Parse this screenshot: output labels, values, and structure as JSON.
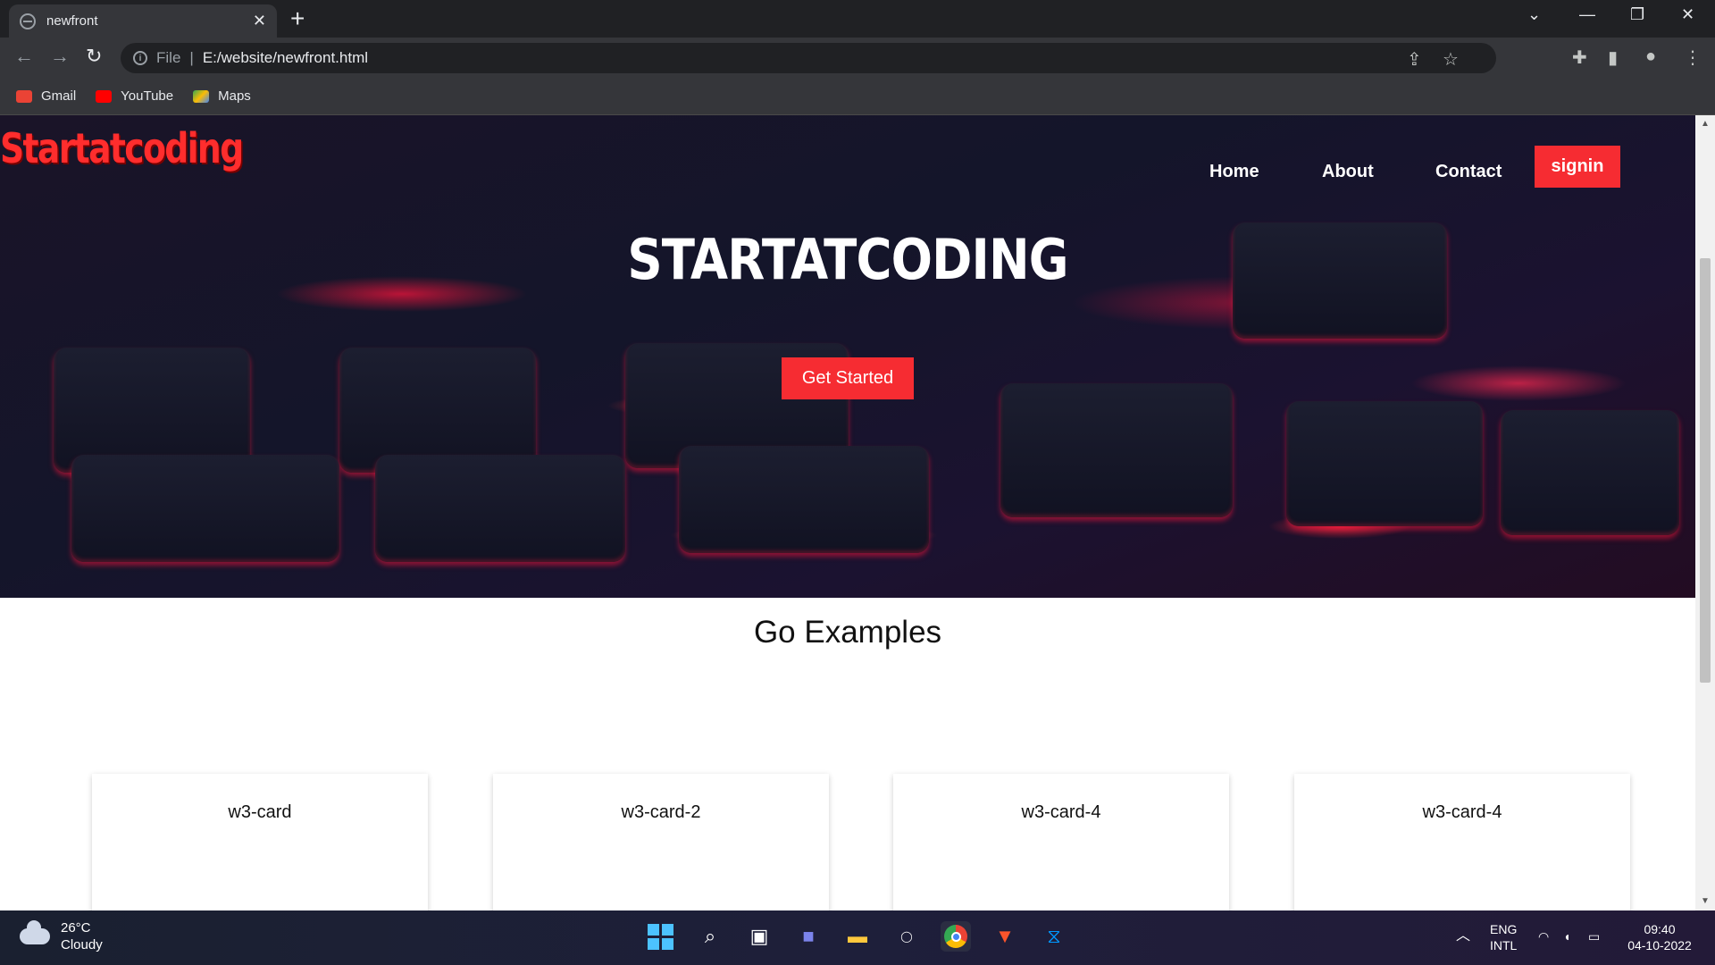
{
  "browser": {
    "tab_title": "newfront",
    "tab_close": "✕",
    "new_tab": "+",
    "url_scheme": "File",
    "url": "E:/website/newfront.html",
    "bookmarks": [
      {
        "label": "Gmail",
        "color": "#ea4335"
      },
      {
        "label": "YouTube",
        "color": "#ff0000"
      },
      {
        "label": "Maps",
        "color": "#34a853"
      }
    ]
  },
  "site": {
    "brand": "Startatcoding",
    "nav": [
      "Home",
      "About",
      "Contact"
    ],
    "signin": "signin",
    "hero_title": "STARTATCODING",
    "cta": "Get Started",
    "section_title": "Go Examples",
    "cards": [
      "w3-card",
      "w3-card-2",
      "w3-card-4",
      "w3-card-4"
    ],
    "accent": "#f62c32"
  },
  "taskbar": {
    "temperature": "26°C",
    "weather": "Cloudy",
    "lang_1": "ENG",
    "lang_2": "INTL",
    "time": "09:40",
    "date": "04-10-2022"
  }
}
